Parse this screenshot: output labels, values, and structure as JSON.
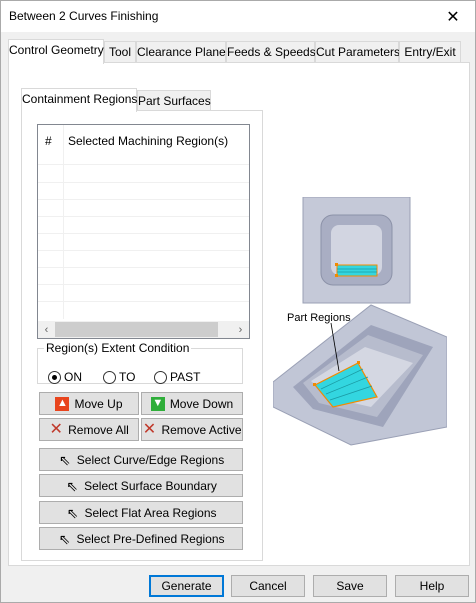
{
  "window": {
    "title": "Between 2 Curves Finishing",
    "close_glyph": "✕"
  },
  "tabs": [
    {
      "label": "Control Geometry",
      "active": true
    },
    {
      "label": "Tool",
      "active": false
    },
    {
      "label": "Clearance Plane",
      "active": false
    },
    {
      "label": "Feeds & Speeds",
      "active": false
    },
    {
      "label": "Cut Parameters",
      "active": false
    },
    {
      "label": "Entry/Exit",
      "active": false
    }
  ],
  "subtabs": [
    {
      "label": "Containment Regions",
      "active": true
    },
    {
      "label": "Part Surfaces",
      "active": false
    }
  ],
  "regions_list": {
    "columns": [
      "#",
      "Selected Machining Region(s)"
    ],
    "rows": [],
    "scroll_left_glyph": "‹",
    "scroll_right_glyph": "›"
  },
  "extent": {
    "legend": "Region(s) Extent Condition",
    "options": [
      {
        "label": "ON",
        "selected": true
      },
      {
        "label": "TO",
        "selected": false
      },
      {
        "label": "PAST",
        "selected": false
      }
    ]
  },
  "buttons": {
    "move_up": "Move Up",
    "move_down": "Move Down",
    "remove_all": "Remove All",
    "remove_active": "Remove Active",
    "select_curve_edge": "Select Curve/Edge Regions",
    "select_surface_boundary": "Select Surface Boundary",
    "select_flat_area": "Select Flat Area Regions",
    "select_predefined": "Select Pre-Defined Regions"
  },
  "preview": {
    "caption": "Part Regions"
  },
  "footer": {
    "generate": "Generate",
    "cancel": "Cancel",
    "save": "Save",
    "help": "Help"
  },
  "colors": {
    "accent": "#0078d7",
    "region_fill": "#33d6e0",
    "region_outline": "#f28a00",
    "part_body": "#b3b8cc"
  },
  "icons": {
    "move_up": "triangle-up-icon",
    "move_down": "triangle-down-icon",
    "remove": "x-icon",
    "select": "cursor-arrow-icon"
  }
}
